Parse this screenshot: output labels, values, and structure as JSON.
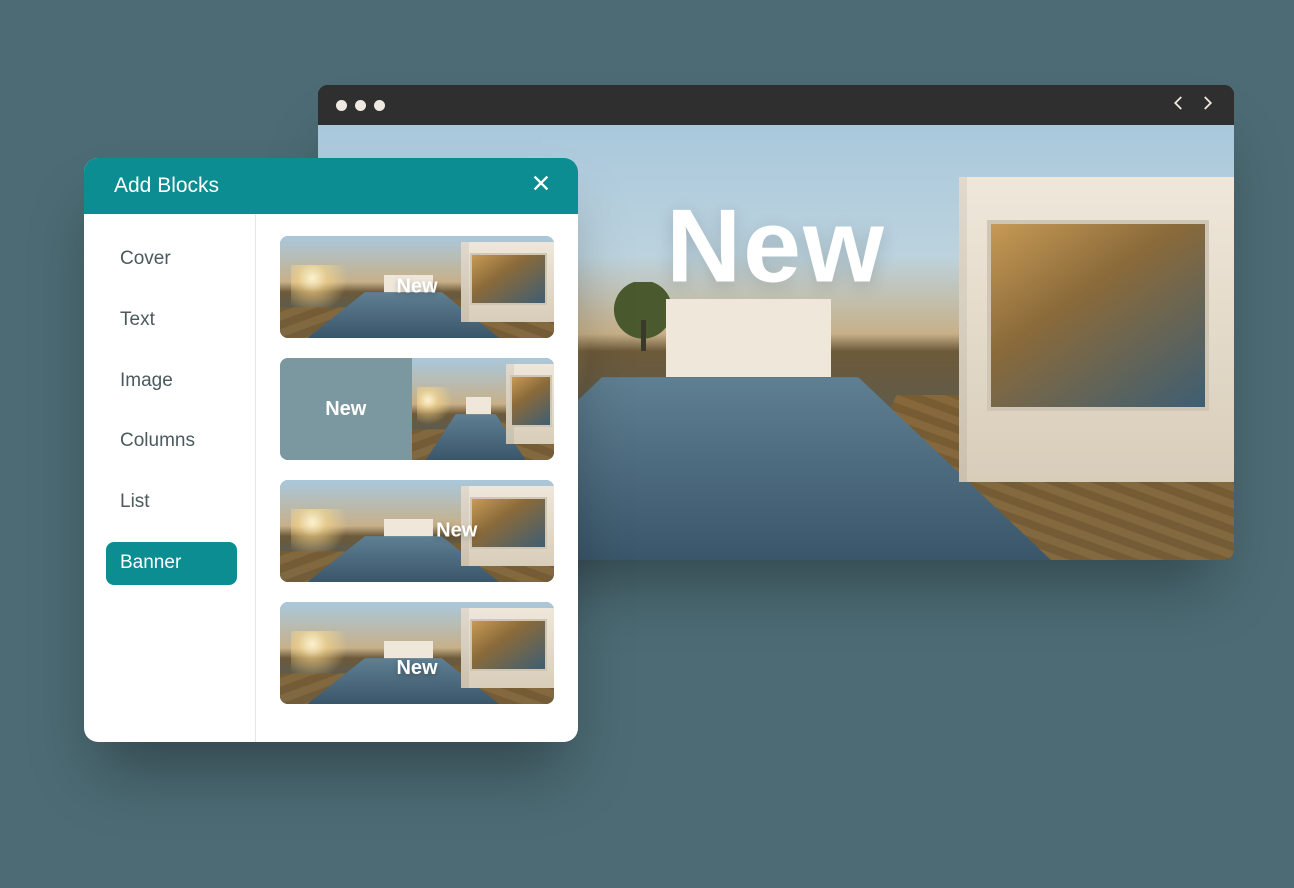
{
  "colors": {
    "page_bg": "#4c6b74",
    "teal": "#0c8d92",
    "panel_bg": "#ffffff",
    "browser_bar": "#2f2f2f"
  },
  "browser": {
    "hero_text": "New"
  },
  "panel": {
    "title": "Add Blocks",
    "categories": [
      {
        "label": "Cover",
        "active": false
      },
      {
        "label": "Text",
        "active": false
      },
      {
        "label": "Image",
        "active": false
      },
      {
        "label": "Columns",
        "active": false
      },
      {
        "label": "List",
        "active": false
      },
      {
        "label": "Banner",
        "active": true
      }
    ],
    "previews": [
      {
        "variant": "center",
        "label": "New"
      },
      {
        "variant": "split",
        "label": "New"
      },
      {
        "variant": "right",
        "label": "New"
      },
      {
        "variant": "low",
        "label": "New"
      }
    ]
  }
}
